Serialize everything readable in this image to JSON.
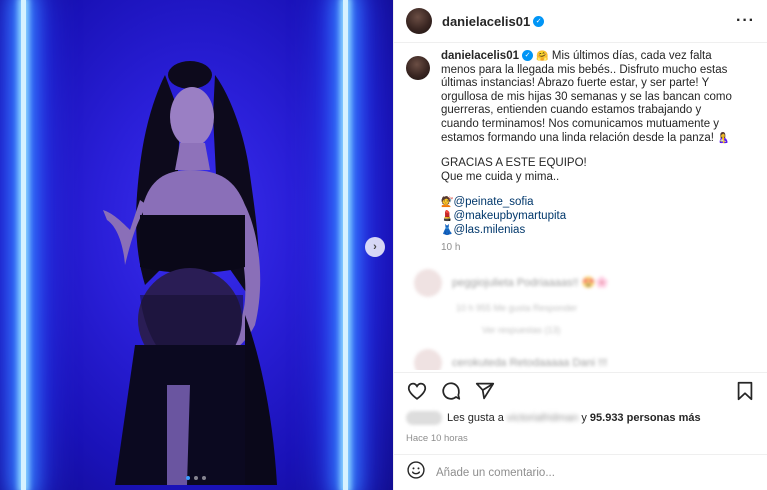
{
  "post": {
    "username": "danielacelis01",
    "caption_lines": [
      "Mis últimos días, cada vez falta menos para",
      "la llegada mis bebés.. Disfruto mucho estas últimas instancias!",
      "Abrazo fuerte estar, y ser parte! Y orgullosa de mis hijas 30",
      "semanas y se las bancan como guerreras, entienden cuando",
      "estamos trabajando y cuando terminamos! Nos comunicamos",
      "mutuamente y estamos formando una linda relación desde la",
      "panza!"
    ],
    "caption_emoji_start": "🤗",
    "caption_emoji_end": "🤱",
    "thanks_1": "GRACIAS A ESTE EQUIPO!",
    "thanks_2": "Que me cuida y mima..",
    "tags": [
      {
        "emoji": "💇",
        "handle": "@peinate_sofia"
      },
      {
        "emoji": "💄",
        "handle": "@makeupbymartupita"
      },
      {
        "emoji": "👗",
        "handle": "@las.milenias"
      }
    ],
    "time": "10 h"
  },
  "blurred": {
    "comment_1": "peggiojulieta Podriaaaas!! 😍🌸",
    "comment_1_meta": "10 h  955 Me gusta  Responder",
    "replies": "Ver respuestas (13)",
    "comment_2": "cerokuteda Retodaaaaa Dani !!!"
  },
  "actions": {
    "likes_prefix": "Les gusta a",
    "likes_blurred_name": "victoriafridman",
    "likes_middle": "y",
    "likes_count": "95.933 personas más",
    "ago": "Hace 10 horas",
    "comment_placeholder": "Añade un comentario..."
  },
  "icons": {
    "more": "more-options-icon",
    "like": "heart-icon",
    "comment": "comment-icon",
    "share": "send-icon",
    "save": "bookmark-icon",
    "emoji": "emoji-icon",
    "next": "chevron-right-icon"
  }
}
